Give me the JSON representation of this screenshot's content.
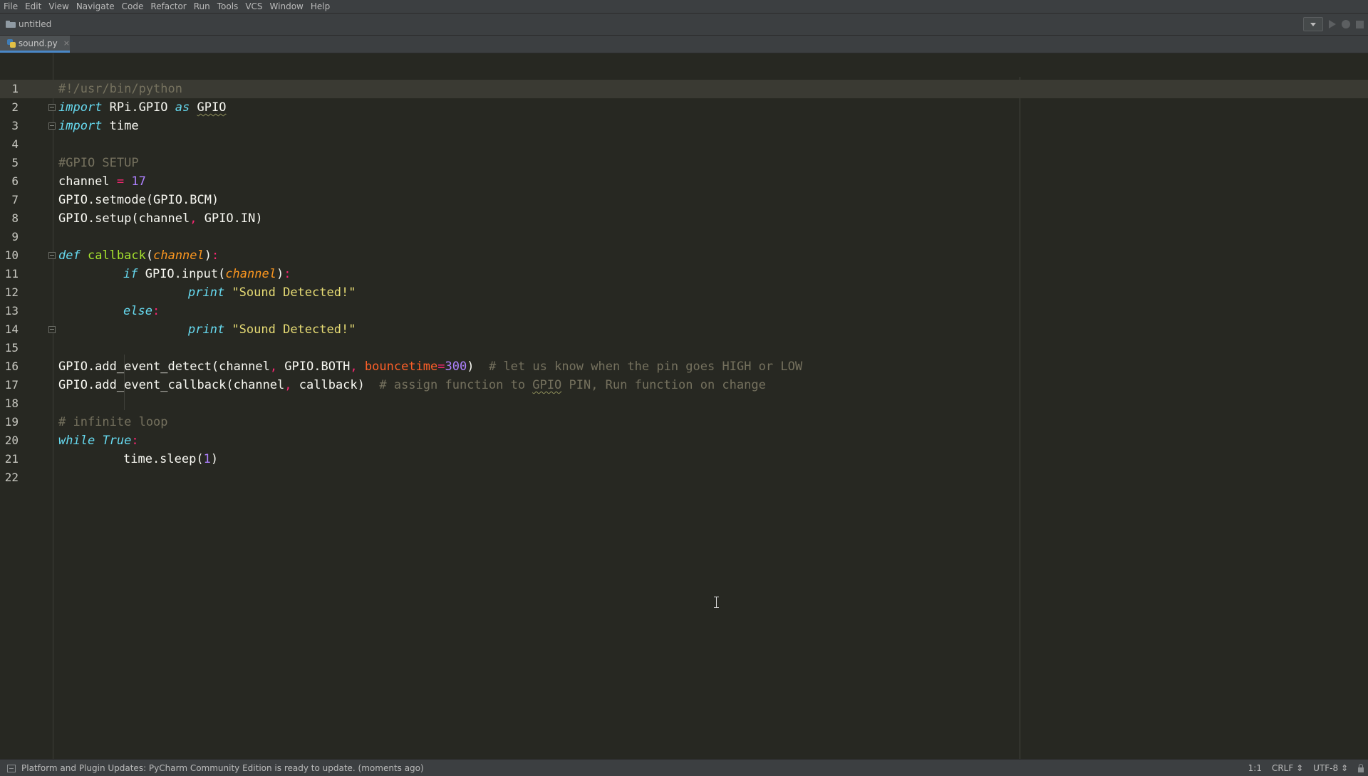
{
  "menu": [
    "File",
    "Edit",
    "View",
    "Navigate",
    "Code",
    "Refactor",
    "Run",
    "Tools",
    "VCS",
    "Window",
    "Help"
  ],
  "breadcrumb": {
    "project": "untitled",
    "icon": "folder-icon"
  },
  "tab": {
    "filename": "sound.py",
    "close": "×",
    "icon": "python-file-icon"
  },
  "editor": {
    "current_line": 1,
    "lines": [
      {
        "n": "1",
        "indent": 0,
        "fold": false,
        "tokens": [
          {
            "t": "#!/usr/bin/python",
            "c": "comment"
          }
        ]
      },
      {
        "n": "2",
        "indent": 0,
        "fold": true,
        "tokens": [
          {
            "t": "import",
            "c": "kw"
          },
          {
            "t": " RPi.GPIO ",
            "c": ""
          },
          {
            "t": "as",
            "c": "kw"
          },
          {
            "t": " ",
            "c": ""
          },
          {
            "t": "GPIO",
            "c": "squig"
          }
        ]
      },
      {
        "n": "3",
        "indent": 0,
        "fold": true,
        "tokens": [
          {
            "t": "import",
            "c": "kw"
          },
          {
            "t": " time",
            "c": ""
          }
        ]
      },
      {
        "n": "4",
        "indent": 0,
        "fold": false,
        "tokens": []
      },
      {
        "n": "5",
        "indent": 0,
        "fold": false,
        "tokens": [
          {
            "t": "#GPIO SETUP",
            "c": "comment"
          }
        ]
      },
      {
        "n": "6",
        "indent": 0,
        "fold": false,
        "tokens": [
          {
            "t": "channel ",
            "c": ""
          },
          {
            "t": "=",
            "c": "punct"
          },
          {
            "t": " ",
            "c": ""
          },
          {
            "t": "17",
            "c": "num"
          }
        ]
      },
      {
        "n": "7",
        "indent": 0,
        "fold": false,
        "tokens": [
          {
            "t": "GPIO.setmode(GPIO.BCM)",
            "c": ""
          }
        ]
      },
      {
        "n": "8",
        "indent": 0,
        "fold": false,
        "tokens": [
          {
            "t": "GPIO.setup(channel",
            "c": ""
          },
          {
            "t": ",",
            "c": "punct"
          },
          {
            "t": " GPIO.IN)",
            "c": ""
          }
        ]
      },
      {
        "n": "9",
        "indent": 0,
        "fold": false,
        "tokens": []
      },
      {
        "n": "10",
        "indent": 0,
        "fold": true,
        "tokens": [
          {
            "t": "def",
            "c": "kw"
          },
          {
            "t": " ",
            "c": ""
          },
          {
            "t": "callback",
            "c": "fn"
          },
          {
            "t": "(",
            "c": ""
          },
          {
            "t": "channel",
            "c": "param"
          },
          {
            "t": ")",
            "c": ""
          },
          {
            "t": ":",
            "c": "punct"
          }
        ]
      },
      {
        "n": "11",
        "indent": 1,
        "fold": false,
        "tokens": [
          {
            "t": "if",
            "c": "kw"
          },
          {
            "t": " GPIO.input(",
            "c": ""
          },
          {
            "t": "channel",
            "c": "param"
          },
          {
            "t": ")",
            "c": ""
          },
          {
            "t": ":",
            "c": "punct"
          }
        ]
      },
      {
        "n": "12",
        "indent": 2,
        "fold": false,
        "tokens": [
          {
            "t": "print",
            "c": "kw"
          },
          {
            "t": " ",
            "c": ""
          },
          {
            "t": "\"Sound Detected!\"",
            "c": "str"
          }
        ]
      },
      {
        "n": "13",
        "indent": 1,
        "fold": false,
        "tokens": [
          {
            "t": "else",
            "c": "kw"
          },
          {
            "t": ":",
            "c": "punct"
          }
        ]
      },
      {
        "n": "14",
        "indent": 2,
        "fold": true,
        "tokens": [
          {
            "t": "print",
            "c": "kw"
          },
          {
            "t": " ",
            "c": ""
          },
          {
            "t": "\"Sound Detected!\"",
            "c": "str"
          }
        ]
      },
      {
        "n": "15",
        "indent": 0,
        "fold": false,
        "tokens": []
      },
      {
        "n": "16",
        "indent": 0,
        "fold": false,
        "tokens": [
          {
            "t": "GPIO.add_event_detect(channel",
            "c": ""
          },
          {
            "t": ",",
            "c": "punct"
          },
          {
            "t": " GPIO.BOTH",
            "c": ""
          },
          {
            "t": ",",
            "c": "punct"
          },
          {
            "t": " ",
            "c": ""
          },
          {
            "t": "bouncetime",
            "c": "named"
          },
          {
            "t": "=",
            "c": "punct"
          },
          {
            "t": "300",
            "c": "num"
          },
          {
            "t": ")  ",
            "c": ""
          },
          {
            "t": "# let us know when the pin goes HIGH or LOW",
            "c": "comment"
          }
        ]
      },
      {
        "n": "17",
        "indent": 0,
        "fold": false,
        "tokens": [
          {
            "t": "GPIO.add_event_callback(channel",
            "c": ""
          },
          {
            "t": ",",
            "c": "punct"
          },
          {
            "t": " callback)  ",
            "c": ""
          },
          {
            "t": "# assign function to ",
            "c": "comment"
          },
          {
            "t": "GPIO",
            "c": "comment squig"
          },
          {
            "t": " PIN, Run function on change",
            "c": "comment"
          }
        ]
      },
      {
        "n": "18",
        "indent": 0,
        "fold": false,
        "tokens": []
      },
      {
        "n": "19",
        "indent": 0,
        "fold": false,
        "tokens": [
          {
            "t": "# infinite loop",
            "c": "comment"
          }
        ]
      },
      {
        "n": "20",
        "indent": 0,
        "fold": false,
        "tokens": [
          {
            "t": "while",
            "c": "kw"
          },
          {
            "t": " ",
            "c": ""
          },
          {
            "t": "True",
            "c": "kw"
          },
          {
            "t": ":",
            "c": "punct"
          }
        ]
      },
      {
        "n": "21",
        "indent": 1,
        "fold": false,
        "tokens": [
          {
            "t": "time.sleep(",
            "c": ""
          },
          {
            "t": "1",
            "c": "num"
          },
          {
            "t": ")",
            "c": ""
          }
        ]
      },
      {
        "n": "22",
        "indent": 0,
        "fold": false,
        "tokens": []
      }
    ]
  },
  "statusbar": {
    "message": "Platform and Plugin Updates: PyCharm Community Edition is ready to update. (moments ago)",
    "position": "1:1",
    "line_separator": "CRLF",
    "encoding": "UTF-8"
  },
  "colors": {
    "editor_bg": "#272822",
    "keyword": "#66d9ef",
    "comment": "#75715e",
    "number": "#ae81ff",
    "string": "#e6db74",
    "function": "#a6e22e",
    "parameter": "#fd971f",
    "accent": "#4a88c7"
  }
}
